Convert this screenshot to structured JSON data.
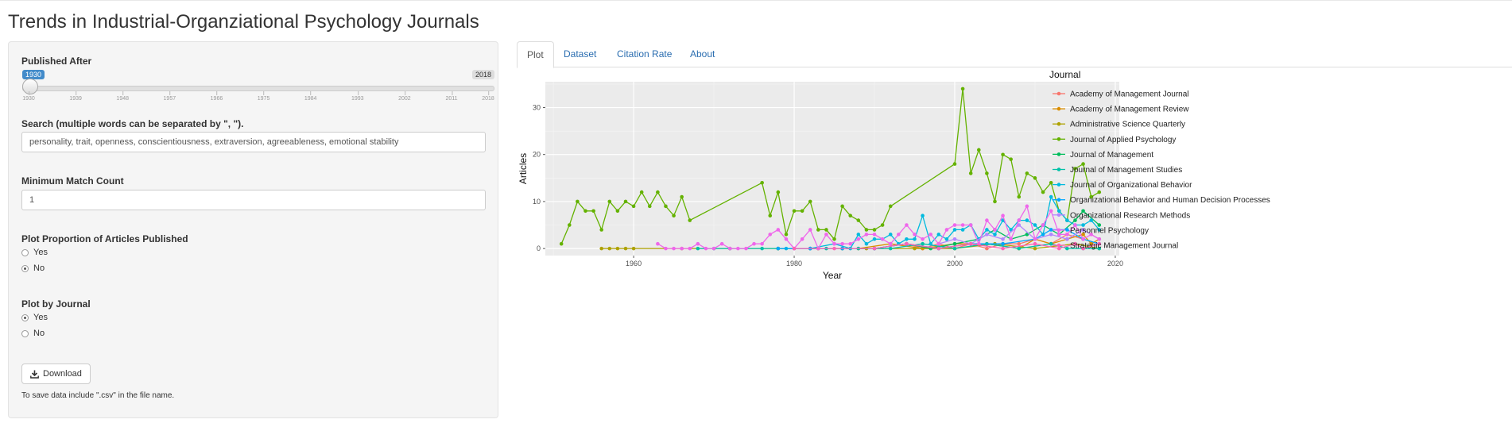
{
  "page": {
    "title": "Trends in Industrial-Organziational Psychology Journals"
  },
  "sidebar": {
    "published_after": {
      "label": "Published After",
      "min": 1930,
      "max": 2018,
      "value": 1930,
      "min_label": "1930",
      "max_label": "2018",
      "ticks": [
        "1930",
        "1939",
        "1948",
        "1957",
        "1966",
        "1975",
        "1984",
        "1993",
        "2002",
        "2011",
        "2018"
      ]
    },
    "search": {
      "label": "Search (multiple words can be separated by \", \").",
      "value": "personality, trait, openness, conscientiousness, extraversion, agreeableness, emotional stability"
    },
    "min_match": {
      "label": "Minimum Match Count",
      "value": "1"
    },
    "proportion": {
      "label": "Plot Proportion of Articles Published",
      "options": [
        "Yes",
        "No"
      ],
      "selected": "No"
    },
    "by_journal": {
      "label": "Plot by Journal",
      "options": [
        "Yes",
        "No"
      ],
      "selected": "Yes"
    },
    "download": {
      "label": "Download",
      "note": "To save data include \".csv\" in the file name."
    }
  },
  "tabs": [
    {
      "label": "Plot",
      "active": true
    },
    {
      "label": "Dataset",
      "active": false
    },
    {
      "label": "Citation Rate",
      "active": false
    },
    {
      "label": "About",
      "active": false
    }
  ],
  "chart_data": {
    "type": "line",
    "xlabel": "Year",
    "ylabel": "Articles",
    "xlim": [
      1949,
      2020.5
    ],
    "ylim": [
      -1.5,
      35.5
    ],
    "xticks": [
      1960,
      1980,
      2000,
      2020
    ],
    "yticks": [
      0,
      10,
      20,
      30
    ],
    "grid": true,
    "legend_title": "Journal",
    "legend_position": "right",
    "series": [
      {
        "name": "Academy of Management Journal",
        "color": "#F8766D",
        "x": [
          1978,
          1982,
          1986,
          1990,
          1994,
          1996,
          1998,
          2000,
          2002,
          2004,
          2006,
          2008,
          2010,
          2012,
          2014,
          2016,
          2018
        ],
        "y": [
          0,
          0,
          0,
          0,
          1,
          0,
          1,
          0,
          1,
          0,
          1,
          1,
          2,
          1,
          3,
          2,
          1
        ]
      },
      {
        "name": "Academy of Management Review",
        "color": "#DB8E00",
        "x": [
          1978,
          1983,
          1988,
          1992,
          1996,
          2000,
          2004,
          2008,
          2010,
          2012,
          2014,
          2016,
          2017,
          2018
        ],
        "y": [
          0,
          0,
          0,
          1,
          0,
          1,
          1,
          0,
          2,
          1,
          2,
          3,
          1,
          2
        ]
      },
      {
        "name": "Administrative Science Quarterly",
        "color": "#AEA200",
        "x": [
          1956,
          1957,
          1958,
          1959,
          1960,
          1966,
          1972,
          1978,
          1983,
          1989,
          1995,
          2000,
          2005,
          2010,
          2015,
          2018
        ],
        "y": [
          0,
          0,
          0,
          0,
          0,
          0,
          0,
          0,
          0,
          0,
          0,
          0,
          1,
          0,
          1,
          0
        ]
      },
      {
        "name": "Journal of Applied Psychology",
        "color": "#64B200",
        "x": [
          1951,
          1952,
          1953,
          1954,
          1955,
          1956,
          1957,
          1958,
          1959,
          1960,
          1961,
          1962,
          1963,
          1964,
          1965,
          1966,
          1967,
          1976,
          1977,
          1978,
          1979,
          1980,
          1981,
          1982,
          1983,
          1984,
          1985,
          1986,
          1987,
          1988,
          1989,
          1990,
          1991,
          1992,
          2000,
          2001,
          2002,
          2003,
          2004,
          2005,
          2006,
          2007,
          2008,
          2009,
          2010,
          2011,
          2012,
          2013,
          2014,
          2015,
          2016,
          2017,
          2018
        ],
        "y": [
          1,
          5,
          10,
          8,
          8,
          4,
          10,
          8,
          10,
          9,
          12,
          9,
          12,
          9,
          7,
          11,
          6,
          14,
          7,
          12,
          3,
          8,
          8,
          10,
          4,
          4,
          2,
          9,
          7,
          6,
          4,
          4,
          5,
          9,
          18,
          34,
          16,
          21,
          16,
          10,
          20,
          19,
          11,
          16,
          15,
          12,
          14,
          8,
          6,
          17,
          18,
          11,
          12
        ]
      },
      {
        "name": "Journal of Management",
        "color": "#00BD5C",
        "x": [
          1978,
          1982,
          1986,
          1990,
          1994,
          1997,
          2000,
          2003,
          2005,
          2007,
          2009,
          2011,
          2013,
          2015,
          2016,
          2018
        ],
        "y": [
          0,
          0,
          0,
          0,
          1,
          0,
          1,
          2,
          4,
          2,
          3,
          5,
          3,
          6,
          8,
          5
        ]
      },
      {
        "name": "Journal of Management Studies",
        "color": "#00C1A7",
        "x": [
          1968,
          1970,
          1972,
          1976,
          1980,
          1984,
          1988,
          1992,
          1996,
          2000,
          2004,
          2008,
          2012,
          2014,
          2016,
          2018
        ],
        "y": [
          0,
          0,
          0,
          0,
          0,
          0,
          0,
          0,
          1,
          0,
          1,
          0,
          1,
          0,
          0,
          0
        ]
      },
      {
        "name": "Journal of Organizational Behavior",
        "color": "#00BADE",
        "x": [
          1979,
          1982,
          1985,
          1987,
          1988,
          1989,
          1990,
          1991,
          1992,
          1993,
          1994,
          1995,
          1996,
          1997,
          1998,
          1999,
          2000,
          2001,
          2002,
          2003,
          2004,
          2005,
          2006,
          2007,
          2008,
          2009,
          2010,
          2011,
          2012,
          2013,
          2014,
          2015,
          2016,
          2017,
          2018
        ],
        "y": [
          0,
          0,
          1,
          0,
          3,
          1,
          2,
          2,
          3,
          1,
          2,
          2,
          7,
          1,
          3,
          2,
          4,
          4,
          5,
          2,
          4,
          3,
          6,
          4,
          6,
          6,
          5,
          3,
          11,
          8,
          6,
          5,
          5,
          6,
          4
        ]
      },
      {
        "name": "Organizational Behavior and Human Decision Processes",
        "color": "#00A6FF",
        "x": [
          1978,
          1982,
          1986,
          1990,
          1994,
          1998,
          2002,
          2006,
          2010,
          2012,
          2014,
          2016,
          2018
        ],
        "y": [
          0,
          0,
          0,
          0,
          1,
          0,
          1,
          1,
          2,
          4,
          4,
          2,
          1
        ]
      },
      {
        "name": "Organizational Research Methods",
        "color": "#B385FF",
        "x": [
          1998,
          2000,
          2002,
          2004,
          2006,
          2008,
          2010,
          2012,
          2014,
          2016,
          2018
        ],
        "y": [
          1,
          2,
          1,
          3,
          2,
          5,
          2,
          3,
          2,
          4,
          2
        ]
      },
      {
        "name": "Personnel Psychology",
        "color": "#EF67EB",
        "x": [
          1963,
          1964,
          1965,
          1966,
          1967,
          1968,
          1969,
          1970,
          1971,
          1972,
          1973,
          1974,
          1975,
          1976,
          1977,
          1978,
          1979,
          1980,
          1981,
          1982,
          1983,
          1984,
          1985,
          1986,
          1987,
          1988,
          1989,
          1990,
          1991,
          1992,
          1993,
          1994,
          1995,
          1996,
          1997,
          1998,
          1999,
          2000,
          2001,
          2002,
          2003,
          2004,
          2005,
          2006,
          2007,
          2008,
          2009,
          2010,
          2011,
          2012,
          2013,
          2014,
          2015,
          2016,
          2017,
          2018
        ],
        "y": [
          1,
          0,
          0,
          0,
          0,
          1,
          0,
          0,
          1,
          0,
          0,
          0,
          1,
          1,
          3,
          4,
          2,
          0,
          2,
          4,
          0,
          3,
          1,
          1,
          1,
          2,
          3,
          3,
          2,
          1,
          3,
          5,
          3,
          2,
          3,
          1,
          4,
          5,
          5,
          5,
          1,
          6,
          4,
          7,
          2,
          6,
          9,
          2,
          5,
          8,
          3,
          3,
          5,
          2,
          3,
          2
        ]
      },
      {
        "name": "Strategic Management Journal",
        "color": "#FF63B6",
        "x": [
          1980,
          1985,
          1990,
          1994,
          1998,
          2002,
          2006,
          2010,
          2013,
          2015,
          2016,
          2018
        ],
        "y": [
          0,
          0,
          0,
          1,
          0,
          1,
          0,
          1,
          0,
          1,
          0,
          1
        ]
      }
    ]
  }
}
